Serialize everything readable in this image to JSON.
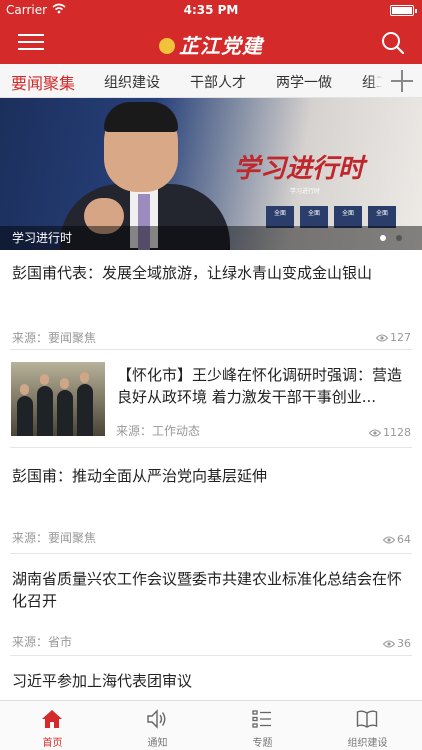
{
  "status_bar": {
    "carrier": "Carrier",
    "time": "4:35 PM"
  },
  "header": {
    "title": "芷江党建",
    "menu_icon": "hamburger-icon",
    "search_icon": "search-icon"
  },
  "tabs": [
    {
      "label": "要闻聚集",
      "active": true
    },
    {
      "label": "组织建设",
      "active": false
    },
    {
      "label": "干部人才",
      "active": false
    },
    {
      "label": "两学一做",
      "active": false
    },
    {
      "label": "组工",
      "active": false
    }
  ],
  "banner": {
    "caption": "学习进行时",
    "slogan": "学习进行时",
    "slogan_sub": "学习进行时",
    "chips": [
      "全面",
      "全面",
      "全面",
      "全面"
    ],
    "page_count": 2,
    "current_page": 1
  },
  "news": [
    {
      "title": "彭国甫代表：发展全域旅游，让绿水青山变成金山银山",
      "source": "来源：要闻聚焦",
      "views": "127",
      "has_image": false
    },
    {
      "title": "【怀化市】王少峰在怀化调研时强调：营造良好从政环境 着力激发干部干事创业...",
      "source": "来源：工作动态",
      "views": "1128",
      "has_image": true
    },
    {
      "title": "彭国甫：推动全面从严治党向基层延伸",
      "source": "来源：要闻聚焦",
      "views": "64",
      "has_image": false
    },
    {
      "title": "湖南省质量兴农工作会议暨委市共建农业标准化总结会在怀化召开",
      "source": "来源：省市",
      "views": "36",
      "has_image": false
    },
    {
      "title": "习近平参加上海代表团审议",
      "source": "",
      "views": "",
      "has_image": false
    }
  ],
  "tab_bar": [
    {
      "label": "首页",
      "icon": "home-icon",
      "active": true
    },
    {
      "label": "通知",
      "icon": "speaker-icon",
      "active": false
    },
    {
      "label": "专题",
      "icon": "list-icon",
      "active": false
    },
    {
      "label": "组织建设",
      "icon": "book-icon",
      "active": false
    }
  ],
  "colors": {
    "brand_red": "#d42a2a",
    "tab_active": "#d42a2a",
    "muted_text": "#999999"
  }
}
